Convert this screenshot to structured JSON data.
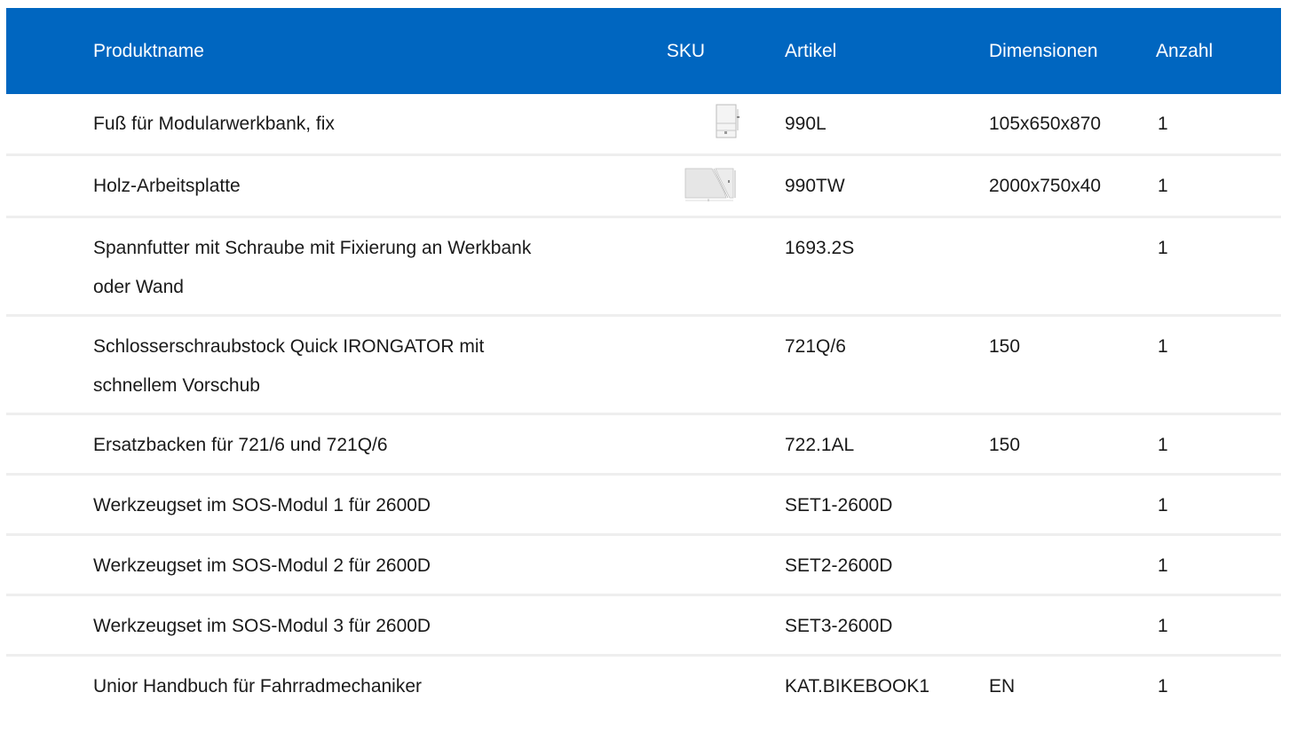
{
  "table": {
    "headers": {
      "name": "Produktname",
      "sku": "SKU",
      "article": "Artikel",
      "dimensions": "Dimensionen",
      "quantity": "Anzahl"
    },
    "rows": [
      {
        "name": "Fuß für Modularwerkbank, fix",
        "thumbnail": "workbench-leg-drawing",
        "article": "990L",
        "dimensions": "105x650x870",
        "quantity": "1"
      },
      {
        "name": "Holz-Arbeitsplatte",
        "thumbnail": "wooden-worktop-drawing",
        "article": "990TW",
        "dimensions": "2000x750x40",
        "quantity": "1"
      },
      {
        "name": "Spannfutter mit Schraube mit Fixierung an Werkbank oder Wand",
        "thumbnail": "",
        "article": "1693.2S",
        "dimensions": "",
        "quantity": "1"
      },
      {
        "name": "Schlosserschraubstock Quick IRONGATOR mit schnellem Vorschub",
        "thumbnail": "",
        "article": "721Q/6",
        "dimensions": "150",
        "quantity": "1"
      },
      {
        "name": "Ersatzbacken für 721/6 und 721Q/6",
        "thumbnail": "",
        "article": "722.1AL",
        "dimensions": "150",
        "quantity": "1"
      },
      {
        "name": "Werkzeugset im SOS-Modul 1 für 2600D",
        "thumbnail": "",
        "article": "SET1-2600D",
        "dimensions": "",
        "quantity": "1"
      },
      {
        "name": "Werkzeugset im SOS-Modul 2 für 2600D",
        "thumbnail": "",
        "article": "SET2-2600D",
        "dimensions": "",
        "quantity": "1"
      },
      {
        "name": "Werkzeugset im SOS-Modul 3 für 2600D",
        "thumbnail": "",
        "article": "SET3-2600D",
        "dimensions": "",
        "quantity": "1"
      },
      {
        "name": "Unior Handbuch für Fahrradmechaniker",
        "thumbnail": "",
        "article": "KAT.BIKEBOOK1",
        "dimensions": "EN",
        "quantity": "1"
      }
    ]
  },
  "colors": {
    "header_bg": "#0066c0",
    "header_text": "#ffffff",
    "row_divider": "#eeeeee",
    "body_text": "#1a1a1a"
  }
}
